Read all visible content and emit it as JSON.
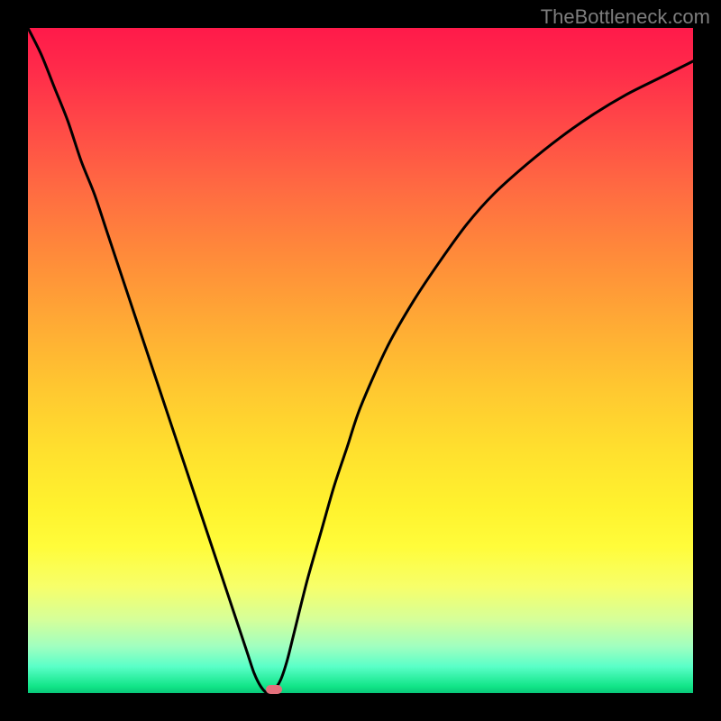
{
  "watermark": "TheBottleneck.com",
  "chart_data": {
    "type": "line",
    "title": "",
    "xlabel": "",
    "ylabel": "",
    "xlim": [
      0,
      100
    ],
    "ylim": [
      0,
      100
    ],
    "series": [
      {
        "name": "bottleneck-curve",
        "x": [
          0,
          2,
          4,
          6,
          8,
          10,
          12,
          14,
          16,
          18,
          20,
          22,
          24,
          26,
          28,
          30,
          32,
          33,
          34,
          35,
          36,
          37,
          38,
          39,
          40,
          42,
          44,
          46,
          48,
          50,
          54,
          58,
          62,
          66,
          70,
          75,
          80,
          85,
          90,
          95,
          100
        ],
        "y": [
          100,
          96,
          91,
          86,
          80,
          75,
          69,
          63,
          57,
          51,
          45,
          39,
          33,
          27,
          21,
          15,
          9,
          6,
          3,
          1,
          0,
          0.5,
          2,
          5,
          9,
          17,
          24,
          31,
          37,
          43,
          52,
          59,
          65,
          70.5,
          75,
          79.5,
          83.5,
          87,
          90,
          92.5,
          95
        ]
      }
    ],
    "marker": {
      "x": 37,
      "y": 0.5
    },
    "background_gradient": {
      "top": "#ff1a4a",
      "middle": "#ffe12e",
      "bottom": "#09c87a"
    }
  }
}
